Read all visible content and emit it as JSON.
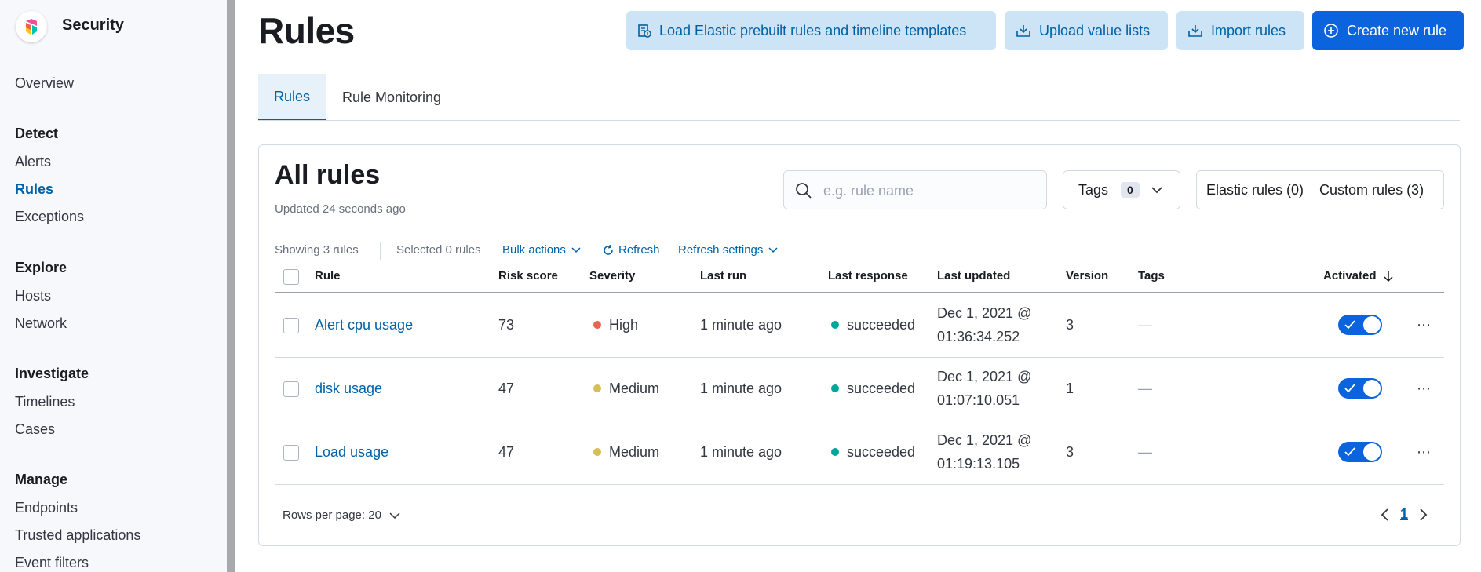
{
  "app": {
    "title": "Security"
  },
  "sidebar": {
    "overview": "Overview",
    "groups": [
      {
        "heading": "Detect",
        "items": [
          "Alerts",
          "Rules",
          "Exceptions"
        ]
      },
      {
        "heading": "Explore",
        "items": [
          "Hosts",
          "Network"
        ]
      },
      {
        "heading": "Investigate",
        "items": [
          "Timelines",
          "Cases"
        ]
      },
      {
        "heading": "Manage",
        "items": [
          "Endpoints",
          "Trusted applications",
          "Event filters"
        ]
      }
    ],
    "active_item": "Rules"
  },
  "header": {
    "title": "Rules",
    "buttons": {
      "load_prebuilt": "Load Elastic prebuilt rules and timeline templates",
      "upload_lists": "Upload value lists",
      "import_rules": "Import rules",
      "create_rule": "Create new rule"
    }
  },
  "tabs": [
    "Rules",
    "Rule Monitoring"
  ],
  "active_tab": "Rules",
  "panel": {
    "title": "All rules",
    "updated": "Updated 24 seconds ago",
    "search_placeholder": "e.g. rule name",
    "tags_label": "Tags",
    "tags_count": "0",
    "elastic_rules": "Elastic rules (0)",
    "custom_rules": "Custom rules (3)"
  },
  "utility_bar": {
    "showing": "Showing 3 rules",
    "selected": "Selected 0 rules",
    "bulk_actions": "Bulk actions",
    "refresh": "Refresh",
    "refresh_settings": "Refresh settings"
  },
  "table": {
    "columns": [
      "Rule",
      "Risk score",
      "Severity",
      "Last run",
      "Last response",
      "Last updated",
      "Version",
      "Tags",
      "Activated"
    ],
    "rows": [
      {
        "rule": "Alert cpu usage",
        "risk": "73",
        "severity": "High",
        "severity_color": "#e7664c",
        "last_run": "1 minute ago",
        "response": "succeeded",
        "updated_1": "Dec 1, 2021 @",
        "updated_2": "01:36:34.252",
        "version": "3",
        "tags": "—",
        "activated": true
      },
      {
        "rule": "disk usage",
        "risk": "47",
        "severity": "Medium",
        "severity_color": "#d6bf57",
        "last_run": "1 minute ago",
        "response": "succeeded",
        "updated_1": "Dec 1, 2021 @",
        "updated_2": "01:07:10.051",
        "version": "1",
        "tags": "—",
        "activated": true
      },
      {
        "rule": "Load usage",
        "risk": "47",
        "severity": "Medium",
        "severity_color": "#d6bf57",
        "last_run": "1 minute ago",
        "response": "succeeded",
        "updated_1": "Dec 1, 2021 @",
        "updated_2": "01:19:13.105",
        "version": "3",
        "tags": "—",
        "activated": true
      }
    ],
    "response_color": "#00a69b"
  },
  "pagination": {
    "rows_per_page": "Rows per page: 20",
    "current_page": "1"
  },
  "icons": {
    "logo": "security-logo-icon",
    "load": "load-prebuilt-icon",
    "upload": "upload-icon",
    "import": "import-icon",
    "create": "plus-circle-icon",
    "search": "search-icon",
    "chevron": "chevron-down-icon",
    "refresh": "refresh-icon",
    "sort": "arrow-down-icon",
    "more": "more-actions-icon",
    "prev": "chevron-left-icon",
    "next": "chevron-right-icon"
  },
  "colors": {
    "primary": "#0b64dd",
    "link": "#0061a6",
    "light_button": "#cce4f5"
  }
}
